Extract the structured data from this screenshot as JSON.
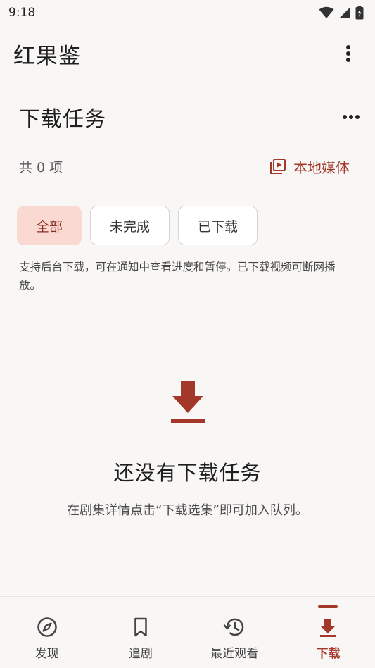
{
  "status_bar": {
    "time": "9:18",
    "icons": [
      "wifi-icon",
      "signal-icon",
      "battery-icon"
    ]
  },
  "app_bar": {
    "title": "红果鉴",
    "menu_icon": "more-vert-icon"
  },
  "section": {
    "title": "下载任务",
    "more_icon": "more-horiz-icon"
  },
  "summary": {
    "count_text": "共 0 项",
    "local_media_label": "本地媒体",
    "local_media_icon": "video-library-icon"
  },
  "filters": [
    {
      "label": "全部",
      "active": true
    },
    {
      "label": "未完成",
      "active": false
    },
    {
      "label": "已下载",
      "active": false
    }
  ],
  "hint": "支持后台下载，可在通知中查看进度和暂停。已下载视频可断网播放。",
  "empty_state": {
    "icon": "download-icon",
    "title": "还没有下载任务",
    "subtitle": "在剧集详情点击“下载选集”即可加入队列。"
  },
  "bottom_nav": [
    {
      "label": "发现",
      "icon": "compass-icon",
      "active": false
    },
    {
      "label": "追剧",
      "icon": "bookmark-icon",
      "active": false
    },
    {
      "label": "最近观看",
      "icon": "history-icon",
      "active": false
    },
    {
      "label": "下载",
      "icon": "download-icon",
      "active": true
    }
  ],
  "colors": {
    "accent": "#a3382a",
    "background": "#f9f7f5",
    "chip_active_bg": "#fbd9d3"
  }
}
